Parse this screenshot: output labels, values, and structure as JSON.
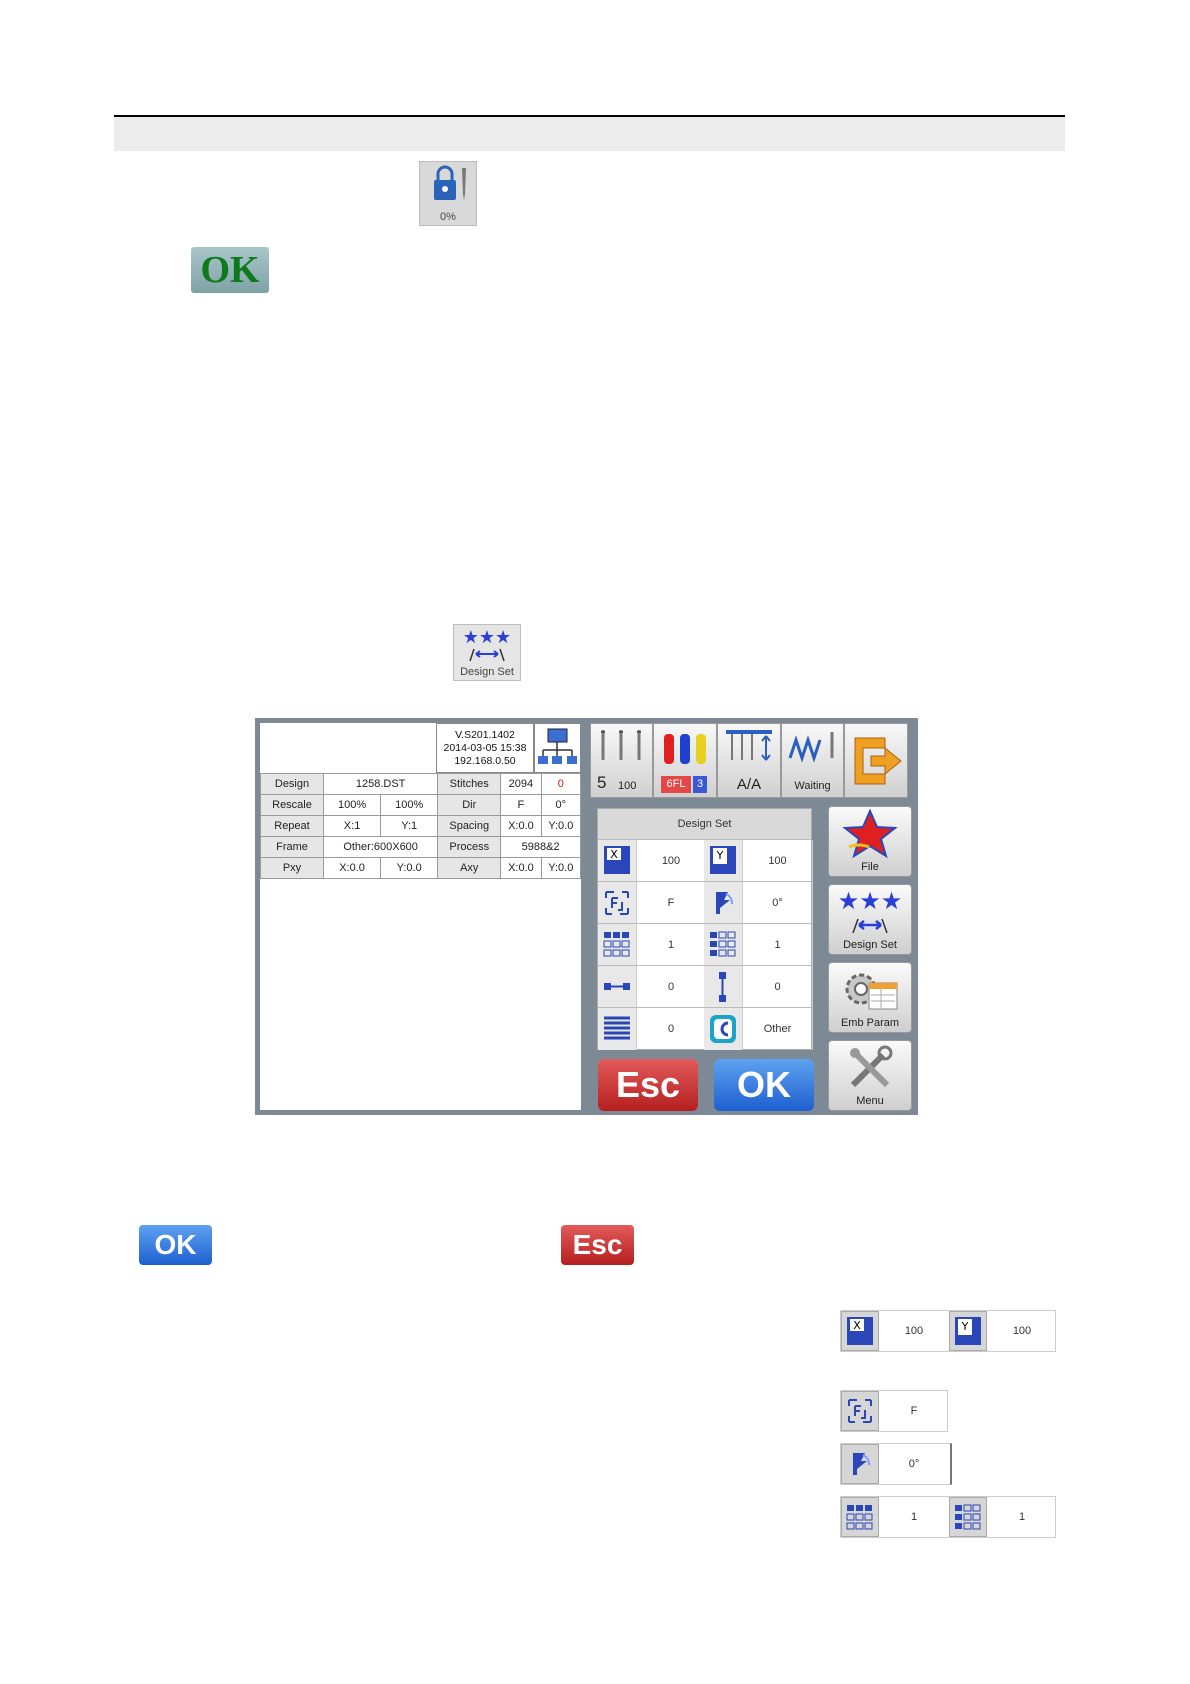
{
  "lock_icon": {
    "icon": "lock-needle-icon",
    "label": "0%"
  },
  "ok_green": {
    "label": "OK"
  },
  "design_set_small": {
    "icon": "design-set-icon",
    "label": "Design Set"
  },
  "screen": {
    "info": {
      "version": "V.S201.1402",
      "datetime": "2014-03-05 15:38",
      "ip": "192.168.0.50"
    },
    "params": [
      {
        "l1": "Design",
        "v1": "1258.DST",
        "l2": "Stitches",
        "v2a": "2094",
        "v2b": "0"
      },
      {
        "l1": "Rescale",
        "v1a": "100%",
        "v1b": "100%",
        "l2": "Dir",
        "v2a": "F",
        "v2b": "0°"
      },
      {
        "l1": "Repeat",
        "v1a": "X:1",
        "v1b": "Y:1",
        "l2": "Spacing",
        "v2a": "X:0.0",
        "v2b": "Y:0.0"
      },
      {
        "l1": "Frame",
        "v1": "Other:600X600",
        "l2": "Process",
        "v2": "5988&2"
      },
      {
        "l1": "Pxy",
        "v1a": "X:0.0",
        "v1b": "Y:0.0",
        "l2": "Axy",
        "v2a": "X:0.0",
        "v2b": "Y:0.0"
      }
    ],
    "top": {
      "needle_num": "5",
      "speed": "100",
      "color_code": "6FL",
      "color_num": "3",
      "aa": "A/A",
      "status": "Waiting"
    },
    "design_set": {
      "title": "Design Set",
      "x_scale": "100",
      "y_scale": "100",
      "direction": "F",
      "angle": "0°",
      "repeat_x": "1",
      "repeat_y": "1",
      "spacing_x": "0",
      "spacing_y": "0",
      "lines": "0",
      "frame": "Other"
    },
    "side": {
      "file": "File",
      "design_set": "Design Set",
      "emb_param": "Emb Param",
      "menu": "Menu"
    },
    "esc": "Esc",
    "ok": "OK"
  },
  "legend": {
    "ok": "OK",
    "esc": "Esc"
  },
  "examples": {
    "x_val": "100",
    "y_val": "100",
    "dir_val": "F",
    "angle_val": "0°",
    "rep_x_val": "1",
    "rep_y_val": "1"
  }
}
